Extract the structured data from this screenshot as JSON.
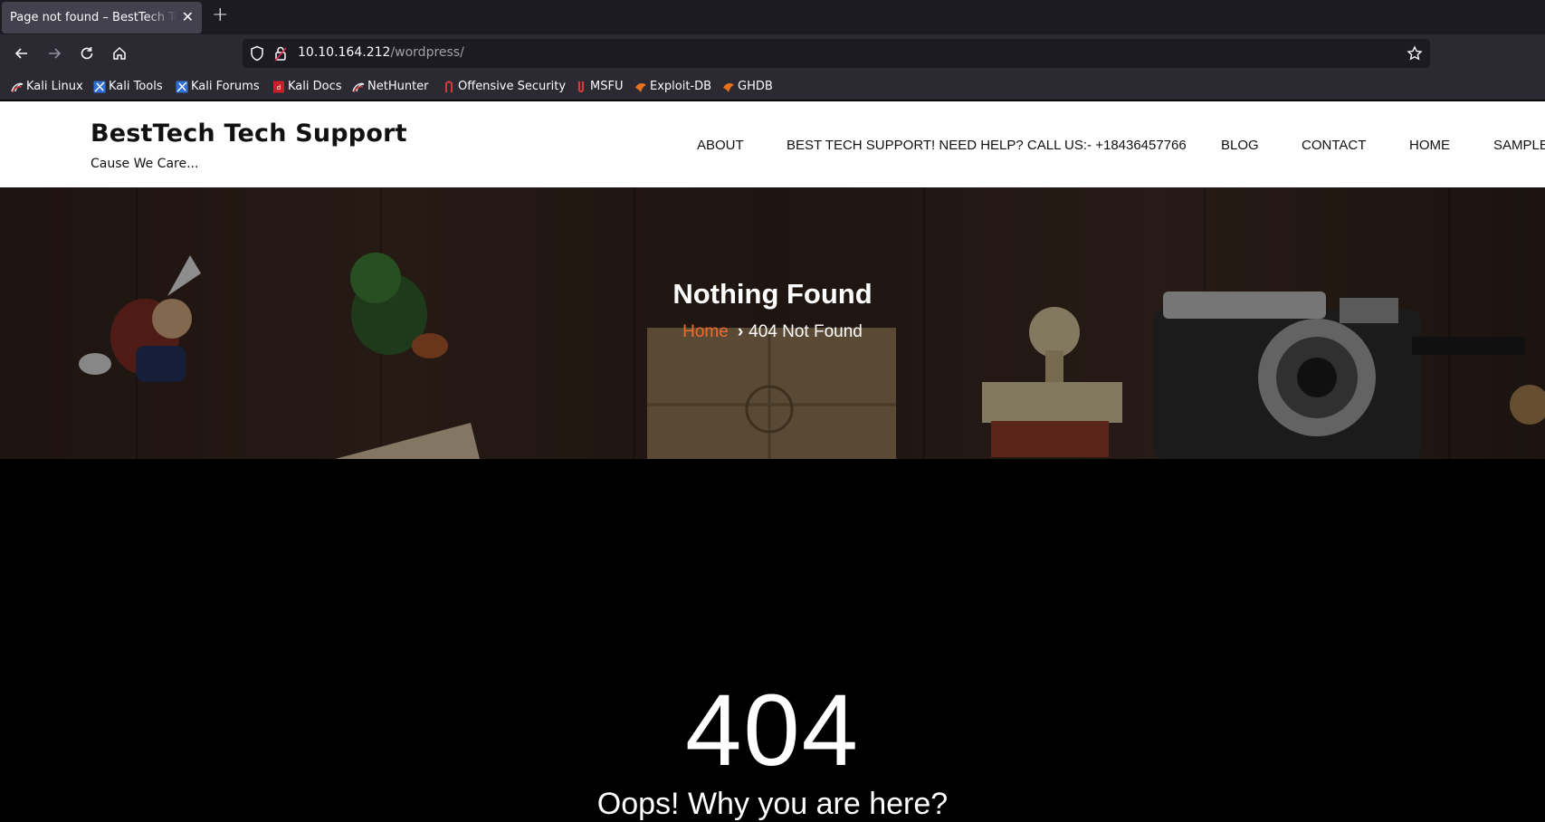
{
  "browser": {
    "tab_title": "Page not found – BestTech Tech Support",
    "url_host": "10.10.164.212",
    "url_path": "/wordpress/",
    "bookmarks": [
      {
        "label": "Kali Linux",
        "icon": "kali-dragon-icon"
      },
      {
        "label": "Kali Tools",
        "icon": "kali-tools-icon"
      },
      {
        "label": "Kali Forums",
        "icon": "kali-forums-icon"
      },
      {
        "label": "Kali Docs",
        "icon": "kali-docs-icon"
      },
      {
        "label": "NetHunter",
        "icon": "nethunter-icon"
      },
      {
        "label": "Offensive Security",
        "icon": "offsec-icon"
      },
      {
        "label": "MSFU",
        "icon": "msfu-icon"
      },
      {
        "label": "Exploit-DB",
        "icon": "exploitdb-icon"
      },
      {
        "label": "GHDB",
        "icon": "ghdb-icon"
      }
    ]
  },
  "site": {
    "title": "BestTech Tech Support",
    "tagline": "Cause We Care...",
    "menu": [
      "ABOUT",
      "BEST TECH SUPPORT! NEED HELP? CALL US:- +18436457766",
      "BLOG",
      "CONTACT",
      "HOME",
      "SAMPLE"
    ]
  },
  "hero": {
    "title": "Nothing Found",
    "breadcrumb_home": "Home",
    "breadcrumb_current": "404 Not Found"
  },
  "error": {
    "code": "404",
    "message": "Oops! Why you are here?"
  },
  "colors": {
    "accent": "#f26a2a",
    "chrome_dark": "#1c1b22",
    "chrome_mid": "#2b2a33"
  }
}
